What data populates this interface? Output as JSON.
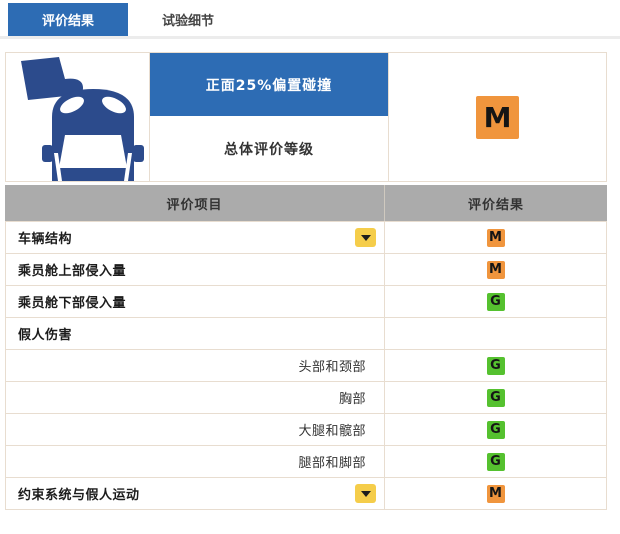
{
  "tabs": [
    {
      "label": "评价结果",
      "active": true
    },
    {
      "label": "试验细节",
      "active": false
    }
  ],
  "summary": {
    "test_name": "正面25%偏置碰撞",
    "overall_label": "总体评价等级",
    "overall_grade": "M"
  },
  "table": {
    "headers": [
      "评价项目",
      "评价结果"
    ],
    "rows": [
      {
        "label": "车辆结构",
        "style": "main",
        "dropdown": true,
        "grade": "M"
      },
      {
        "label": "乘员舱上部侵入量",
        "style": "main",
        "dropdown": false,
        "grade": "M"
      },
      {
        "label": "乘员舱下部侵入量",
        "style": "main",
        "dropdown": false,
        "grade": "G"
      },
      {
        "label": "假人伤害",
        "style": "main",
        "dropdown": false,
        "grade": ""
      },
      {
        "label": "头部和颈部",
        "style": "sub",
        "dropdown": false,
        "grade": "G"
      },
      {
        "label": "胸部",
        "style": "sub",
        "dropdown": false,
        "grade": "G"
      },
      {
        "label": "大腿和髋部",
        "style": "sub",
        "dropdown": false,
        "grade": "G"
      },
      {
        "label": "腿部和脚部",
        "style": "sub",
        "dropdown": false,
        "grade": "G"
      },
      {
        "label": "约束系统与假人运动",
        "style": "main",
        "dropdown": true,
        "grade": "M"
      }
    ]
  },
  "icons": {
    "crash_icon": "small-overlap-frontal-crash-car",
    "dropdown_icon": "chevron-down ▼"
  },
  "colors": {
    "accent_blue": "#2d6cb4",
    "icon_navy": "#2c4b8c",
    "header_gray": "#ababab",
    "border": "#e8ddd0",
    "dropdown_yellow": "#f5cd4a",
    "grade_M": "#f0953d",
    "grade_G": "#55c12f"
  }
}
